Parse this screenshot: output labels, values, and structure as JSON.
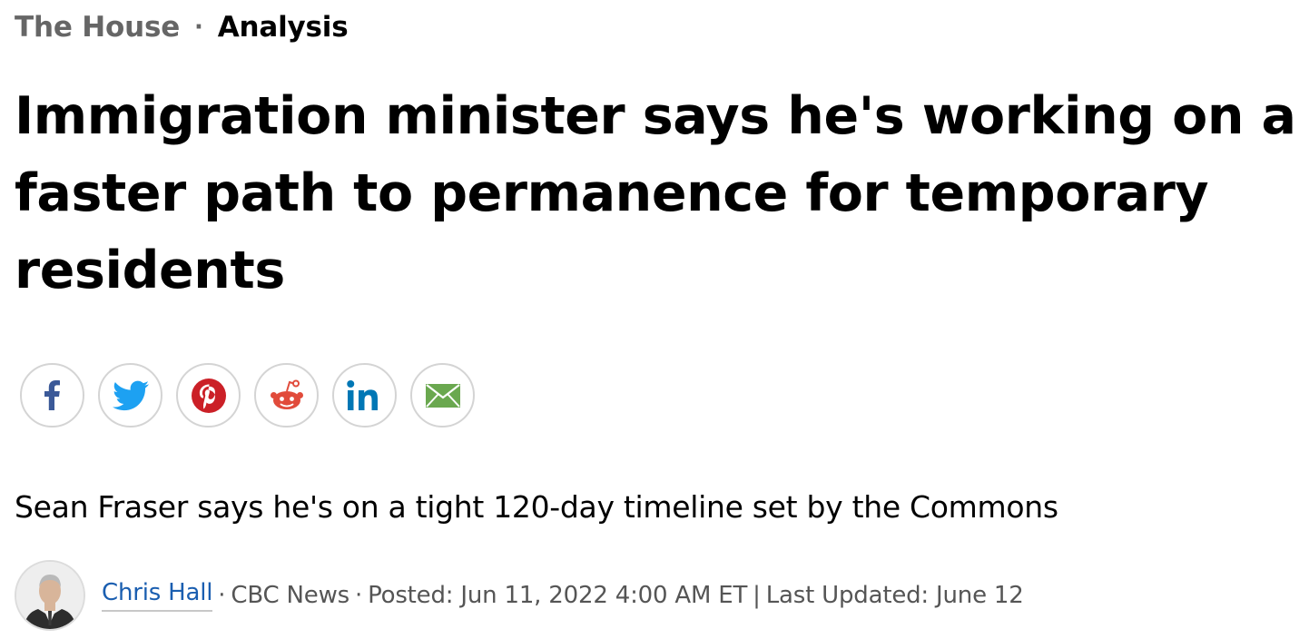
{
  "kicker": {
    "section": "The House",
    "separator": "·",
    "label": "Analysis"
  },
  "headline": "Immigration minister says he's working on a faster path to permanence for temporary residents",
  "share": {
    "buttons": [
      {
        "name": "facebook",
        "icon": "facebook-icon",
        "color": "#3b5998"
      },
      {
        "name": "twitter",
        "icon": "twitter-icon",
        "color": "#1da1f2"
      },
      {
        "name": "pinterest",
        "icon": "pinterest-icon",
        "color": "#cb2027"
      },
      {
        "name": "reddit",
        "icon": "reddit-icon",
        "color": "#ff4500"
      },
      {
        "name": "linkedin",
        "icon": "linkedin-icon",
        "color": "#0077b5"
      },
      {
        "name": "email",
        "icon": "email-icon",
        "color": "#6aa84f"
      }
    ]
  },
  "deck": "Sean Fraser says he's on a tight 120-day timeline set by the Commons",
  "byline": {
    "author": "Chris Hall",
    "dot": "·",
    "outlet": "CBC News",
    "posted": "Posted: Jun 11, 2022 4:00 AM ET",
    "pipe": "|",
    "updated": "Last Updated: June 12"
  },
  "colors": {
    "author_link": "#1a5eb0",
    "muted_text": "#666666"
  }
}
